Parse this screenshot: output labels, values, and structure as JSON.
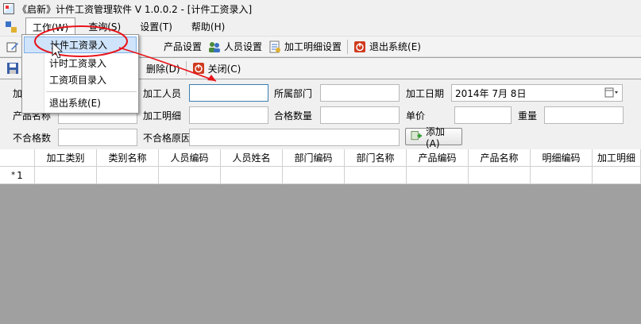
{
  "window": {
    "title": "《启新》计件工资管理软件 V 1.0.0.2 - [计件工资录入]"
  },
  "menubar": {
    "items": [
      {
        "label": "工作(W)"
      },
      {
        "label": "查询(S)"
      },
      {
        "label": "设置(T)"
      },
      {
        "label": "帮助(H)"
      }
    ]
  },
  "toolbar": {
    "product_label": "产品设置",
    "person_label": "人员设置",
    "detail_label": "加工明细设置",
    "exit_label": "退出系统(E)"
  },
  "subtoolbar": {
    "delete_label": "删除(D)",
    "close_label": "关闭(C)"
  },
  "dropdown": {
    "items": [
      {
        "label": "计件工资录入"
      },
      {
        "label": "计时工资录入"
      },
      {
        "label": "工资项目录入"
      },
      {
        "label": "退出系统(E)"
      }
    ]
  },
  "form": {
    "processor_label": "加工人员",
    "processor_value": "",
    "department_label": "所属部门",
    "department_value": "",
    "date_label": "加工日期",
    "date_value": "2014年  7月  8日",
    "product_name_label": "产品名称",
    "product_name_value": "",
    "detail_label": "加工明细",
    "detail_value": "",
    "qualified_label": "合格数量",
    "qualified_value": "",
    "unit_price_label": "单价",
    "unit_price_value": "",
    "weight_label": "重量",
    "weight_value": "",
    "unqualified_label": "不合格数",
    "unqualified_value": "",
    "reason_label": "不合格原因",
    "reason_value": "",
    "add_button": "添加(A)"
  },
  "grid": {
    "columns": [
      "加工类别",
      "类别名称",
      "人员编码",
      "人员姓名",
      "部门编码",
      "部门名称",
      "产品编码",
      "产品名称",
      "明细编码",
      "加工明细"
    ],
    "new_row_marker": "*",
    "new_row_number": "1"
  },
  "colors": {
    "annotation_red": "#e8131a",
    "highlight": "#cfe4fb"
  }
}
